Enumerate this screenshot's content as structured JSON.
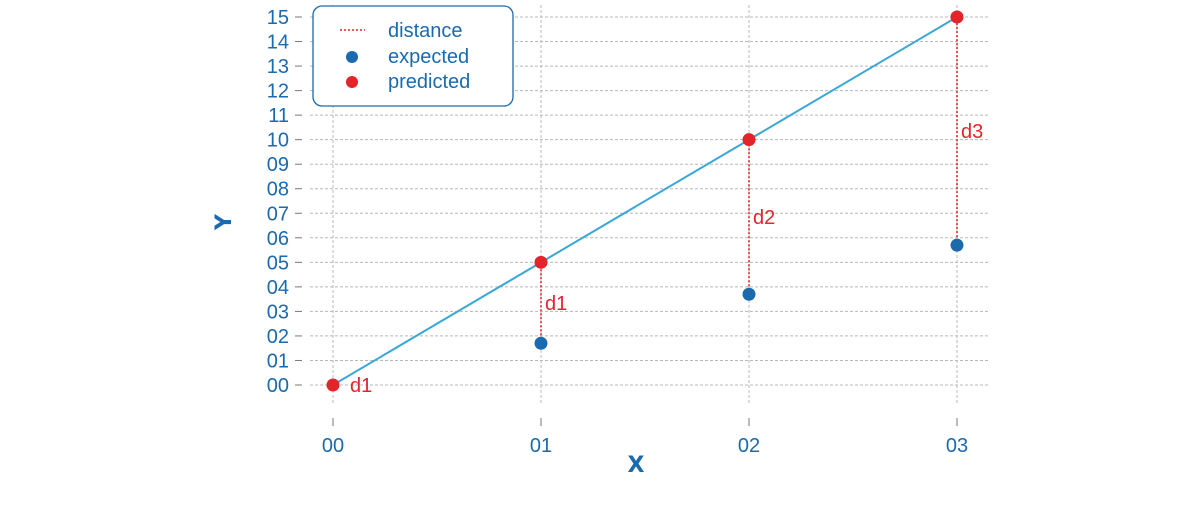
{
  "chart_data": {
    "type": "scatter",
    "title": "",
    "xlabel": "X",
    "ylabel": "Y",
    "xlim": [
      0,
      3
    ],
    "ylim": [
      0,
      15
    ],
    "grid": true,
    "x_ticks": [
      "00",
      "01",
      "02",
      "03"
    ],
    "y_ticks": [
      "00",
      "01",
      "02",
      "03",
      "04",
      "05",
      "06",
      "07",
      "08",
      "09",
      "10",
      "11",
      "12",
      "13",
      "14",
      "15"
    ],
    "legend_position": "top-left",
    "legend": [
      {
        "name": "distance",
        "marker": "dotted-line"
      },
      {
        "name": "expected",
        "marker": "circle"
      },
      {
        "name": "predicted",
        "marker": "circle"
      }
    ],
    "fit_line": {
      "x": [
        0,
        3
      ],
      "y": [
        0,
        15
      ]
    },
    "series": [
      {
        "name": "expected",
        "x": [
          1,
          2,
          3
        ],
        "y": [
          1.7,
          3.7,
          5.7
        ]
      },
      {
        "name": "predicted",
        "x": [
          0,
          1,
          2,
          3
        ],
        "y": [
          0,
          5,
          10,
          15
        ]
      }
    ],
    "distances": [
      {
        "label": "d1",
        "x": 0,
        "from": 0,
        "to": 0
      },
      {
        "label": "d1",
        "x": 1,
        "from": 1.7,
        "to": 5
      },
      {
        "label": "d2",
        "x": 2,
        "from": 3.7,
        "to": 10
      },
      {
        "label": "d3",
        "x": 3,
        "from": 5.7,
        "to": 15
      }
    ],
    "colors": {
      "text": "#1a6aad",
      "expected": "#1a6aad",
      "predicted": "#e3242b",
      "distance": "#e3242b",
      "fit_line": "#3aa7d6",
      "grid": "#b8b8b8"
    }
  }
}
